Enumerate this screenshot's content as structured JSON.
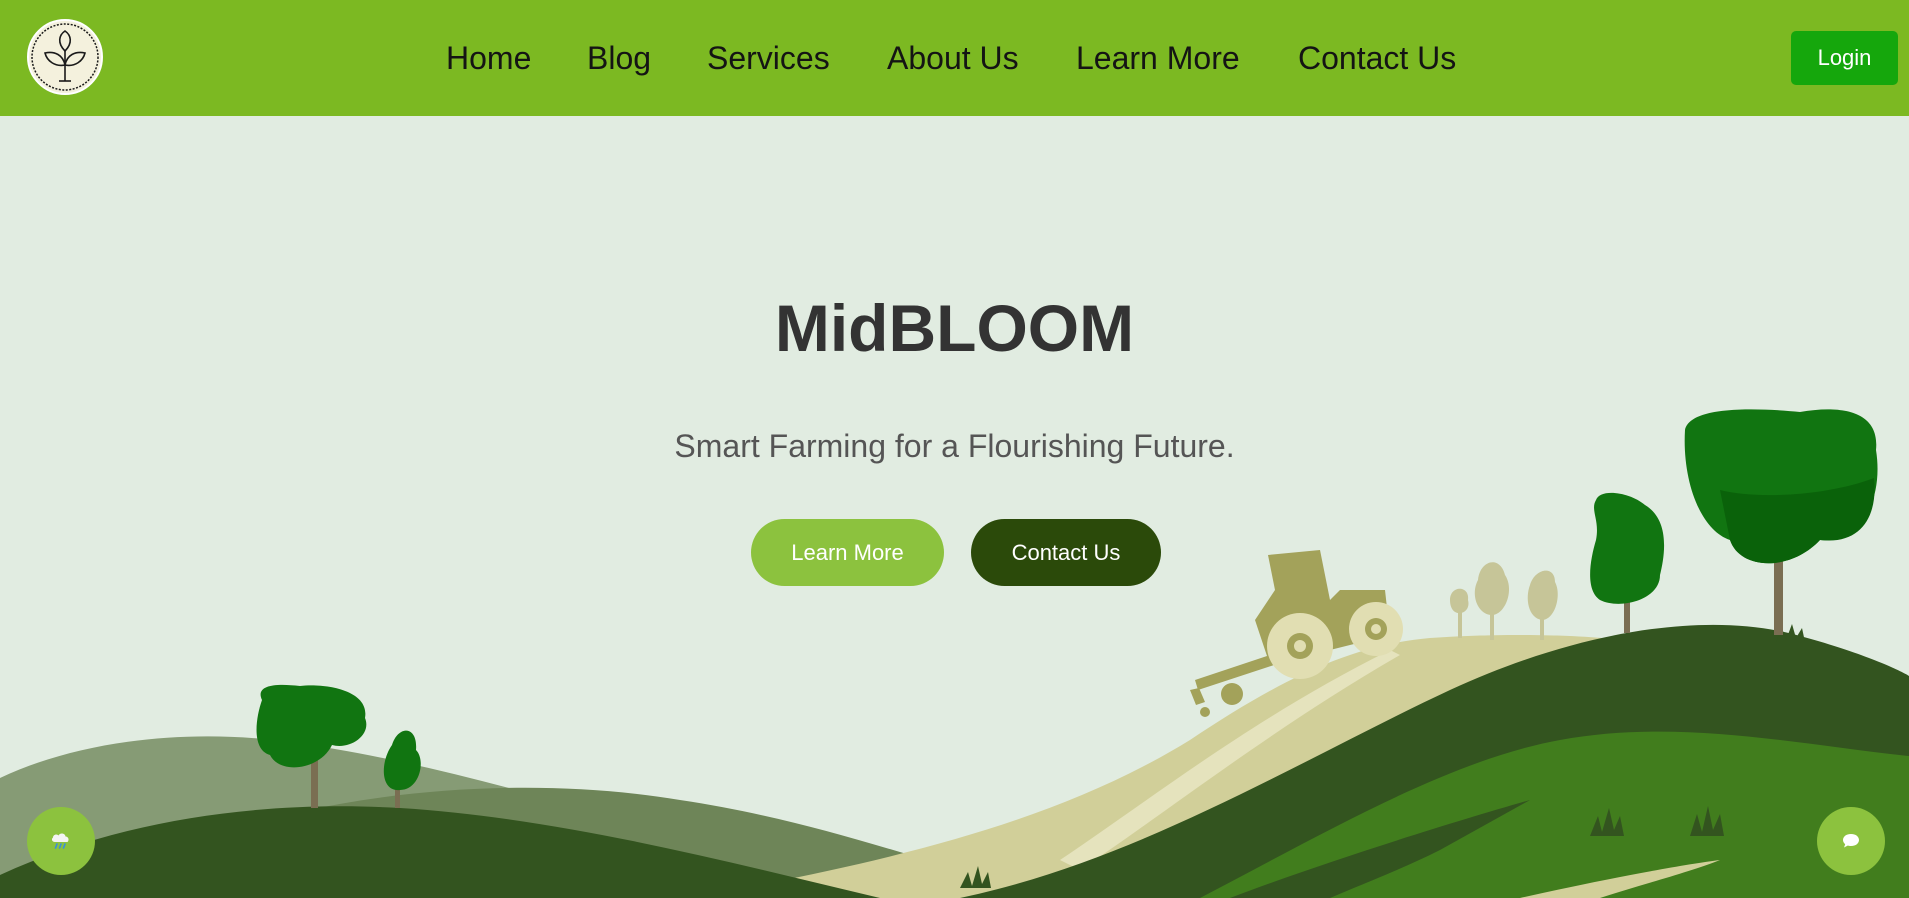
{
  "nav": {
    "items": [
      {
        "label": "Home"
      },
      {
        "label": "Blog"
      },
      {
        "label": "Services"
      },
      {
        "label": "About Us"
      },
      {
        "label": "Learn More"
      },
      {
        "label": "Contact Us"
      }
    ],
    "login_label": "Login",
    "logo_icon": "sprout-logo-icon"
  },
  "hero": {
    "title": "MidBLOOM",
    "subtitle": "Smart Farming for a Flourishing Future.",
    "learn_more_label": "Learn More",
    "contact_label": "Contact Us"
  },
  "floating": {
    "weather_icon": "weather-cloud-rain-icon",
    "chat_icon": "chat-bubble-icon"
  },
  "colors": {
    "navbar": "#7cb922",
    "background": "#e1ece1",
    "login": "#15a70c",
    "learn_more": "#8cc23e",
    "contact": "#2b4a0a",
    "title": "#333333"
  }
}
